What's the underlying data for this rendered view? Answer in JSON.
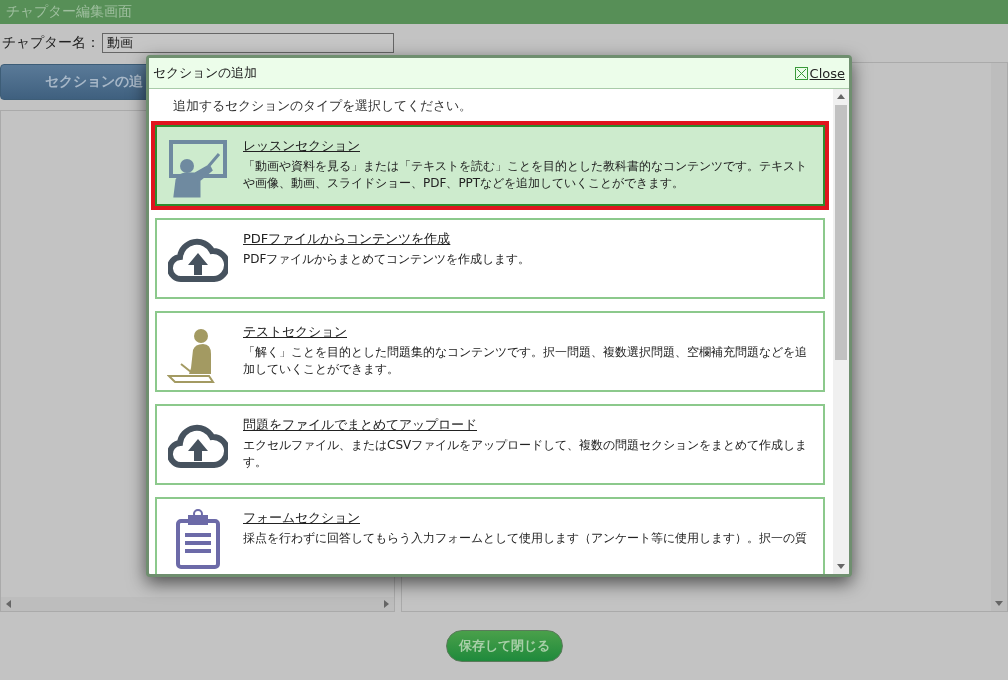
{
  "header": {
    "title": "チャプター編集画面"
  },
  "chapter_name": {
    "label": "チャプター名：",
    "value": "動画"
  },
  "add_section_button": {
    "label": "セクションの追"
  },
  "save_button": {
    "label": "保存して閉じる"
  },
  "dialog": {
    "title": "セクションの追加",
    "close_label": "Close",
    "instruction": "追加するセクションのタイプを選択してください。",
    "items": [
      {
        "kind": "lesson",
        "title": "レッスンセクション",
        "description": "「動画や資料を見る」または「テキストを読む」ことを目的とした教科書的なコンテンツです。テキストや画像、動画、スライドショー、PDF、PPTなどを追加していくことができます。",
        "selected": true
      },
      {
        "kind": "upload",
        "title": "PDFファイルからコンテンツを作成",
        "description": "PDFファイルからまとめてコンテンツを作成します。",
        "selected": false
      },
      {
        "kind": "test",
        "title": "テストセクション",
        "description": "「解く」ことを目的とした問題集的なコンテンツです。択一問題、複数選択問題、空欄補充問題などを追加していくことができます。",
        "selected": false
      },
      {
        "kind": "upload",
        "title": "問題をファイルでまとめてアップロード",
        "description": "エクセルファイル、またはCSVファイルをアップロードして、複数の問題セクションをまとめて作成します。",
        "selected": false
      },
      {
        "kind": "form",
        "title": "フォームセクション",
        "description": "採点を行わずに回答してもらう入力フォームとして使用します（アンケート等に使用します）。択一の質",
        "selected": false
      }
    ]
  }
}
